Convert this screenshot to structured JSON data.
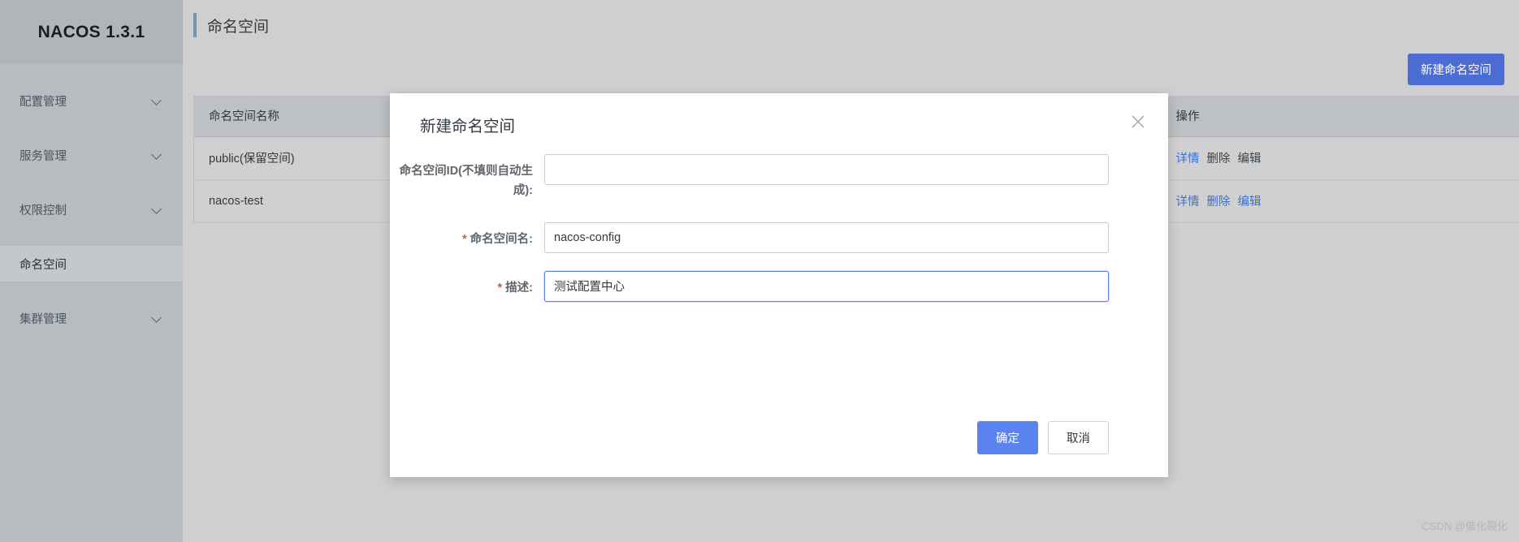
{
  "sidebar": {
    "logo": "NACOS 1.3.1",
    "items": [
      {
        "label": "配置管理",
        "has_chevron": true,
        "selected": false,
        "icon": "chevron-down-icon"
      },
      {
        "label": "服务管理",
        "has_chevron": true,
        "selected": false,
        "icon": "chevron-down-icon"
      },
      {
        "label": "权限控制",
        "has_chevron": true,
        "selected": false,
        "icon": "chevron-down-icon"
      },
      {
        "label": "命名空间",
        "has_chevron": false,
        "selected": true,
        "icon": ""
      },
      {
        "label": "集群管理",
        "has_chevron": true,
        "selected": false,
        "icon": "chevron-down-icon"
      }
    ]
  },
  "header": {
    "title": "命名空间"
  },
  "toolbar": {
    "create_label": "新建命名空间"
  },
  "table": {
    "columns": [
      "命名空间名称",
      "操作"
    ],
    "rows": [
      {
        "name": "public(保留空间)",
        "actions": [
          {
            "label": "详情",
            "muted": false
          },
          {
            "label": "删除",
            "muted": true
          },
          {
            "label": "编辑",
            "muted": true
          }
        ]
      },
      {
        "name": "nacos-test",
        "actions": [
          {
            "label": "详情",
            "muted": false
          },
          {
            "label": "删除",
            "muted": false
          },
          {
            "label": "编辑",
            "muted": false
          }
        ]
      }
    ]
  },
  "dialog": {
    "title": "新建命名空间",
    "close_icon": "close-icon",
    "fields": {
      "namespace_id": {
        "label": "命名空间ID(不填则自动生成):",
        "value": "",
        "placeholder": "",
        "required": false,
        "focused": false
      },
      "namespace_name": {
        "label": "命名空间名:",
        "value": "nacos-config",
        "placeholder": "",
        "required": true,
        "required_mark": "*",
        "focused": false
      },
      "description": {
        "label": "描述:",
        "value": "测试配置中心",
        "placeholder": "",
        "required": true,
        "required_mark": "*",
        "focused": true
      }
    },
    "confirm_label": "确定",
    "cancel_label": "取消"
  },
  "watermark": "CSDN @催化裂化",
  "colors": {
    "primary": "#4a6cd4",
    "dialog_primary": "#5a83f0",
    "link": "#3c6fd0",
    "required": "#e8503a",
    "title_accent": "#7b94ad",
    "sidebar_bg": "#b7bcc0",
    "sidebar_selected": "#c4c7cb",
    "page_bg": "#cfcfcf",
    "table_header_bg": "#bdc0c4",
    "table_row_bg": "#d0d0d0",
    "focus_border": "#5a83e0"
  }
}
